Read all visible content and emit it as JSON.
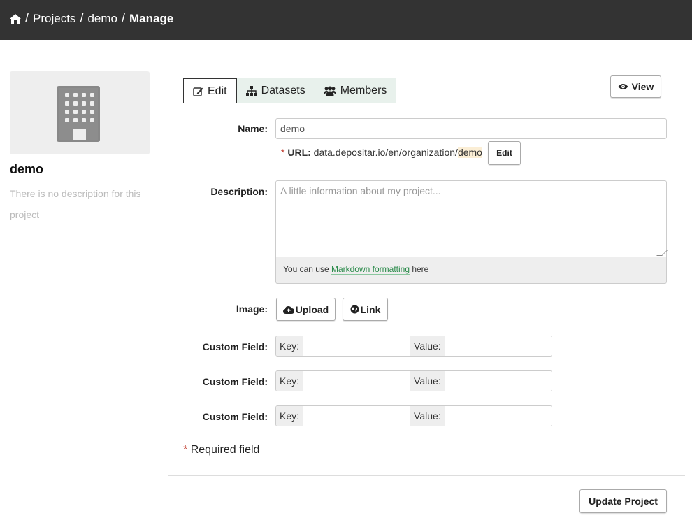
{
  "breadcrumb": {
    "home_icon": "home-icon",
    "separator": "/",
    "items": [
      "Projects",
      "demo"
    ],
    "current": "Manage"
  },
  "sidebar": {
    "image_icon": "building-icon",
    "project_name": "demo",
    "description": "There is no description for this project"
  },
  "tabs": [
    {
      "label": "Edit",
      "icon": "edit-icon",
      "active": true
    },
    {
      "label": "Datasets",
      "icon": "sitemap-icon",
      "active": false
    },
    {
      "label": "Members",
      "icon": "users-icon",
      "active": false
    }
  ],
  "view_button": {
    "label": "View",
    "icon": "eye-icon"
  },
  "form": {
    "name_label": "Name:",
    "name_value": "demo",
    "url": {
      "star": "*",
      "label": "URL:",
      "prefix": "data.depositar.io/en/organization/",
      "slug": "demo",
      "edit_label": "Edit"
    },
    "description_label": "Description:",
    "description_placeholder": "A little information about my project...",
    "markdown_hint": {
      "before": "You can use ",
      "link": "Markdown formatting",
      "after": " here"
    },
    "image_label": "Image:",
    "upload_label": "Upload",
    "upload_icon": "cloud-upload-icon",
    "link_label": "Link",
    "link_icon": "globe-icon",
    "custom_fields": [
      {
        "label": "Custom Field:",
        "key_label": "Key:",
        "key_value": "",
        "value_label": "Value:",
        "value_value": ""
      },
      {
        "label": "Custom Field:",
        "key_label": "Key:",
        "key_value": "",
        "value_label": "Value:",
        "value_value": ""
      },
      {
        "label": "Custom Field:",
        "key_label": "Key:",
        "key_value": "",
        "value_label": "Value:",
        "value_value": ""
      }
    ],
    "required_note": {
      "star": "*",
      "text": "Required field"
    },
    "submit_label": "Update Project"
  },
  "colors": {
    "topbar": "#333333",
    "tab_bg": "#e8f1ec",
    "required": "#c0392b",
    "link": "#2a8a4a",
    "slug_highlight": "#fbeed5"
  }
}
